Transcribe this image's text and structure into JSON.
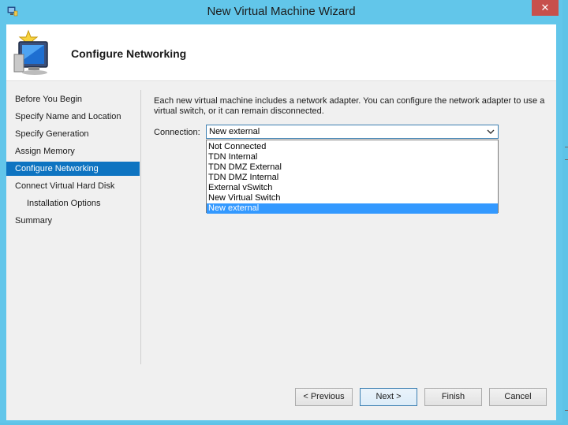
{
  "window": {
    "title": "New Virtual Machine Wizard",
    "close_symbol": "✕"
  },
  "header": {
    "title": "Configure Networking",
    "icon": "computer-wizard-icon"
  },
  "nav": {
    "items": [
      {
        "label": "Before You Begin",
        "sub": false,
        "active": false
      },
      {
        "label": "Specify Name and Location",
        "sub": false,
        "active": false
      },
      {
        "label": "Specify Generation",
        "sub": false,
        "active": false
      },
      {
        "label": "Assign Memory",
        "sub": false,
        "active": false
      },
      {
        "label": "Configure Networking",
        "sub": false,
        "active": true
      },
      {
        "label": "Connect Virtual Hard Disk",
        "sub": false,
        "active": false
      },
      {
        "label": "Installation Options",
        "sub": true,
        "active": false
      },
      {
        "label": "Summary",
        "sub": false,
        "active": false
      }
    ]
  },
  "content": {
    "description": "Each new virtual machine includes a network adapter. You can configure the network adapter to use a virtual switch, or it can remain disconnected.",
    "connection_label": "Connection:",
    "connection_value": "New external",
    "options": [
      "Not Connected",
      "TDN Internal",
      "TDN DMZ External",
      "TDN DMZ Internal",
      "External vSwitch",
      "New Virtual Switch",
      "New external"
    ],
    "selected_option": "New external"
  },
  "buttons": {
    "previous": "< Previous",
    "next": "Next >",
    "finish": "Finish",
    "cancel": "Cancel"
  },
  "colors": {
    "chrome": "#62c6ea",
    "nav_active": "#0e74c1",
    "selection": "#3399ff",
    "close": "#c7504c"
  }
}
